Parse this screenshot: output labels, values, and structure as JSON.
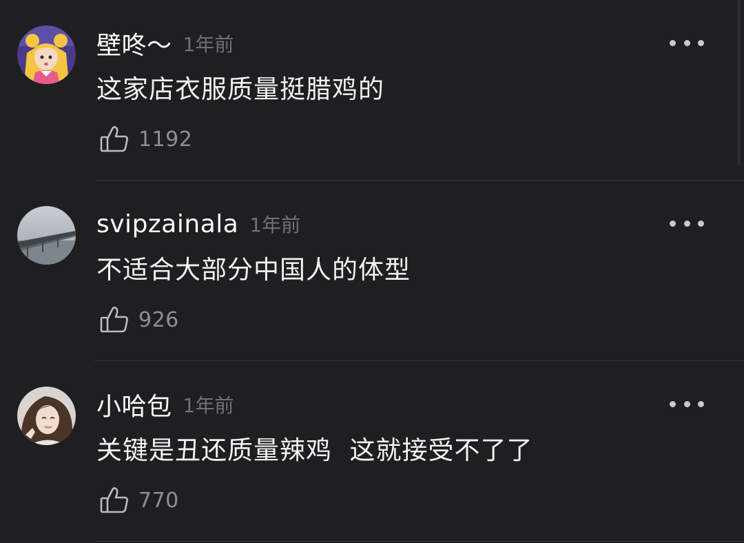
{
  "comments": [
    {
      "username": "壁咚～",
      "time": "1年前",
      "text": "这家店衣服质量挺腊鸡的",
      "likes": "1192",
      "avatar_icon": "anime-girl-avatar"
    },
    {
      "username": "svipzainala",
      "time": "1年前",
      "text": "不适合大部分中国人的体型",
      "likes": "926",
      "avatar_icon": "bridge-landscape-avatar"
    },
    {
      "username": "小哈包",
      "time": "1年前",
      "text": "关键是丑还质量辣鸡  这就接受不了了",
      "likes": "770",
      "avatar_icon": "girl-portrait-avatar"
    }
  ],
  "colors": {
    "background": "#1f1f21",
    "username": "#ffffff",
    "timestamp": "#717175",
    "comment_text": "#f2f2f2",
    "like_count": "#8e8e93",
    "divider": "#39393c"
  }
}
